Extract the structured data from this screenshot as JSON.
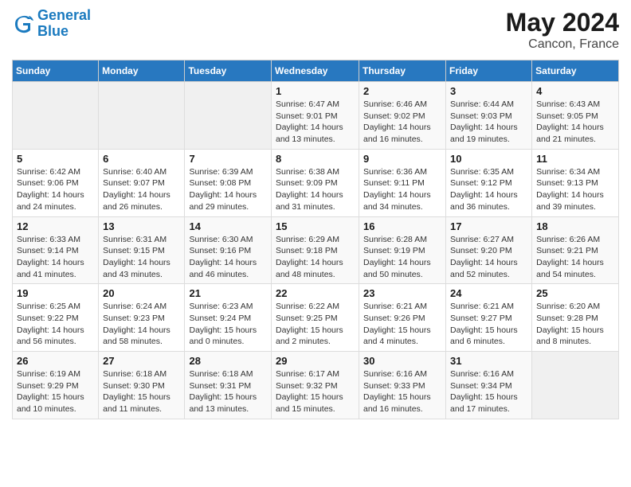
{
  "header": {
    "logo_line1": "General",
    "logo_line2": "Blue",
    "title": "May 2024",
    "subtitle": "Cancon, France"
  },
  "weekdays": [
    "Sunday",
    "Monday",
    "Tuesday",
    "Wednesday",
    "Thursday",
    "Friday",
    "Saturday"
  ],
  "weeks": [
    [
      {
        "day": "",
        "info": ""
      },
      {
        "day": "",
        "info": ""
      },
      {
        "day": "",
        "info": ""
      },
      {
        "day": "1",
        "info": "Sunrise: 6:47 AM\nSunset: 9:01 PM\nDaylight: 14 hours\nand 13 minutes."
      },
      {
        "day": "2",
        "info": "Sunrise: 6:46 AM\nSunset: 9:02 PM\nDaylight: 14 hours\nand 16 minutes."
      },
      {
        "day": "3",
        "info": "Sunrise: 6:44 AM\nSunset: 9:03 PM\nDaylight: 14 hours\nand 19 minutes."
      },
      {
        "day": "4",
        "info": "Sunrise: 6:43 AM\nSunset: 9:05 PM\nDaylight: 14 hours\nand 21 minutes."
      }
    ],
    [
      {
        "day": "5",
        "info": "Sunrise: 6:42 AM\nSunset: 9:06 PM\nDaylight: 14 hours\nand 24 minutes."
      },
      {
        "day": "6",
        "info": "Sunrise: 6:40 AM\nSunset: 9:07 PM\nDaylight: 14 hours\nand 26 minutes."
      },
      {
        "day": "7",
        "info": "Sunrise: 6:39 AM\nSunset: 9:08 PM\nDaylight: 14 hours\nand 29 minutes."
      },
      {
        "day": "8",
        "info": "Sunrise: 6:38 AM\nSunset: 9:09 PM\nDaylight: 14 hours\nand 31 minutes."
      },
      {
        "day": "9",
        "info": "Sunrise: 6:36 AM\nSunset: 9:11 PM\nDaylight: 14 hours\nand 34 minutes."
      },
      {
        "day": "10",
        "info": "Sunrise: 6:35 AM\nSunset: 9:12 PM\nDaylight: 14 hours\nand 36 minutes."
      },
      {
        "day": "11",
        "info": "Sunrise: 6:34 AM\nSunset: 9:13 PM\nDaylight: 14 hours\nand 39 minutes."
      }
    ],
    [
      {
        "day": "12",
        "info": "Sunrise: 6:33 AM\nSunset: 9:14 PM\nDaylight: 14 hours\nand 41 minutes."
      },
      {
        "day": "13",
        "info": "Sunrise: 6:31 AM\nSunset: 9:15 PM\nDaylight: 14 hours\nand 43 minutes."
      },
      {
        "day": "14",
        "info": "Sunrise: 6:30 AM\nSunset: 9:16 PM\nDaylight: 14 hours\nand 46 minutes."
      },
      {
        "day": "15",
        "info": "Sunrise: 6:29 AM\nSunset: 9:18 PM\nDaylight: 14 hours\nand 48 minutes."
      },
      {
        "day": "16",
        "info": "Sunrise: 6:28 AM\nSunset: 9:19 PM\nDaylight: 14 hours\nand 50 minutes."
      },
      {
        "day": "17",
        "info": "Sunrise: 6:27 AM\nSunset: 9:20 PM\nDaylight: 14 hours\nand 52 minutes."
      },
      {
        "day": "18",
        "info": "Sunrise: 6:26 AM\nSunset: 9:21 PM\nDaylight: 14 hours\nand 54 minutes."
      }
    ],
    [
      {
        "day": "19",
        "info": "Sunrise: 6:25 AM\nSunset: 9:22 PM\nDaylight: 14 hours\nand 56 minutes."
      },
      {
        "day": "20",
        "info": "Sunrise: 6:24 AM\nSunset: 9:23 PM\nDaylight: 14 hours\nand 58 minutes."
      },
      {
        "day": "21",
        "info": "Sunrise: 6:23 AM\nSunset: 9:24 PM\nDaylight: 15 hours\nand 0 minutes."
      },
      {
        "day": "22",
        "info": "Sunrise: 6:22 AM\nSunset: 9:25 PM\nDaylight: 15 hours\nand 2 minutes."
      },
      {
        "day": "23",
        "info": "Sunrise: 6:21 AM\nSunset: 9:26 PM\nDaylight: 15 hours\nand 4 minutes."
      },
      {
        "day": "24",
        "info": "Sunrise: 6:21 AM\nSunset: 9:27 PM\nDaylight: 15 hours\nand 6 minutes."
      },
      {
        "day": "25",
        "info": "Sunrise: 6:20 AM\nSunset: 9:28 PM\nDaylight: 15 hours\nand 8 minutes."
      }
    ],
    [
      {
        "day": "26",
        "info": "Sunrise: 6:19 AM\nSunset: 9:29 PM\nDaylight: 15 hours\nand 10 minutes."
      },
      {
        "day": "27",
        "info": "Sunrise: 6:18 AM\nSunset: 9:30 PM\nDaylight: 15 hours\nand 11 minutes."
      },
      {
        "day": "28",
        "info": "Sunrise: 6:18 AM\nSunset: 9:31 PM\nDaylight: 15 hours\nand 13 minutes."
      },
      {
        "day": "29",
        "info": "Sunrise: 6:17 AM\nSunset: 9:32 PM\nDaylight: 15 hours\nand 15 minutes."
      },
      {
        "day": "30",
        "info": "Sunrise: 6:16 AM\nSunset: 9:33 PM\nDaylight: 15 hours\nand 16 minutes."
      },
      {
        "day": "31",
        "info": "Sunrise: 6:16 AM\nSunset: 9:34 PM\nDaylight: 15 hours\nand 17 minutes."
      },
      {
        "day": "",
        "info": ""
      }
    ]
  ]
}
